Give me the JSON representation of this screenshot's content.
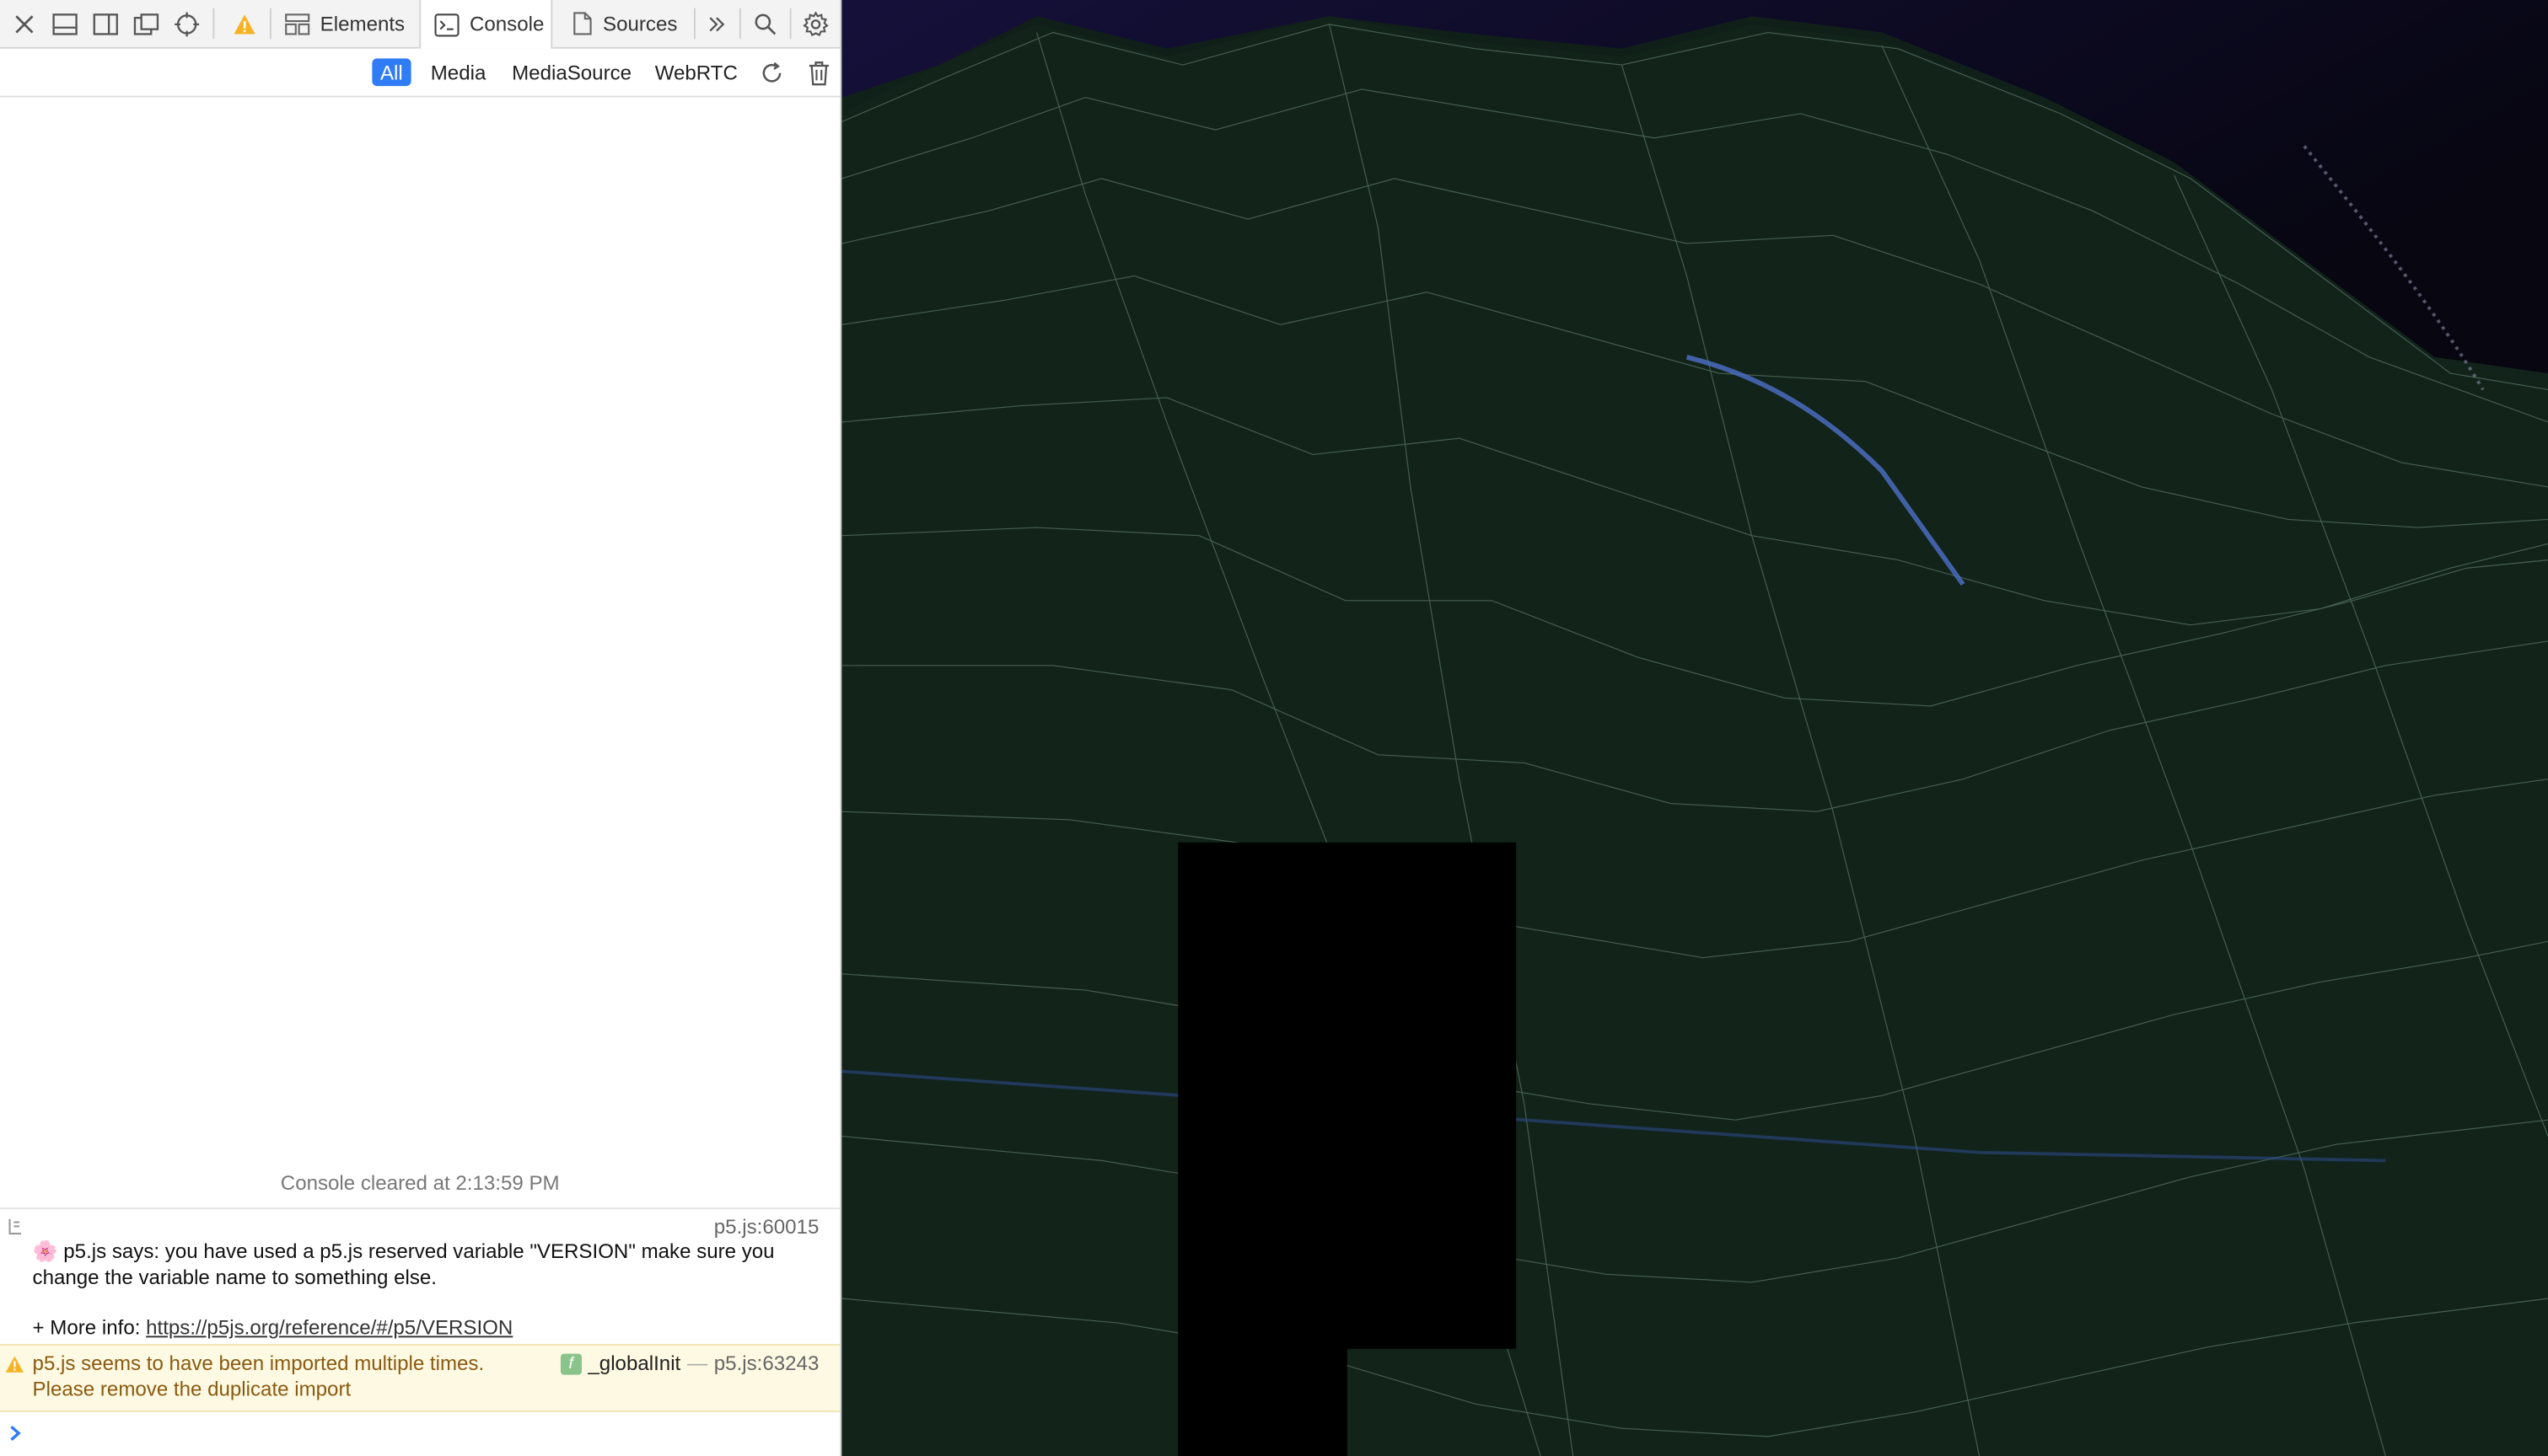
{
  "toolbar": {
    "tabs": [
      {
        "label": "Elements",
        "icon": "elements-icon"
      },
      {
        "label": "Console",
        "icon": "console-icon"
      },
      {
        "label": "Sources",
        "icon": "sources-icon"
      }
    ],
    "active_tab": "Console"
  },
  "filters": {
    "items": [
      "All",
      "Media",
      "MediaSource",
      "WebRTC"
    ],
    "active": "All"
  },
  "console": {
    "cleared_text": "Console cleared at 2:13:59 PM",
    "message1": {
      "source": "p5.js:60015",
      "emoji": "🌸",
      "line1": "p5.js says: you have used a p5.js reserved variable \"VERSION\" make sure you",
      "line2": "change the variable name to something else.",
      "more_prefix": "+ More info: ",
      "more_link": "https://p5js.org/reference/#/p5/VERSION"
    },
    "message2": {
      "line1": "p5.js seems to have been imported multiple times.",
      "line2": "Please remove the duplicate import",
      "function_name": "_globalInit",
      "dash": "—",
      "source": "p5.js:63243"
    }
  },
  "colors": {
    "accent": "#2f7cf6",
    "warning_bg": "#fdf9e2",
    "warning_text": "#8a5a10",
    "canvas_bg": "#0e1a1a",
    "mesh_line": "#5d7a6a"
  }
}
